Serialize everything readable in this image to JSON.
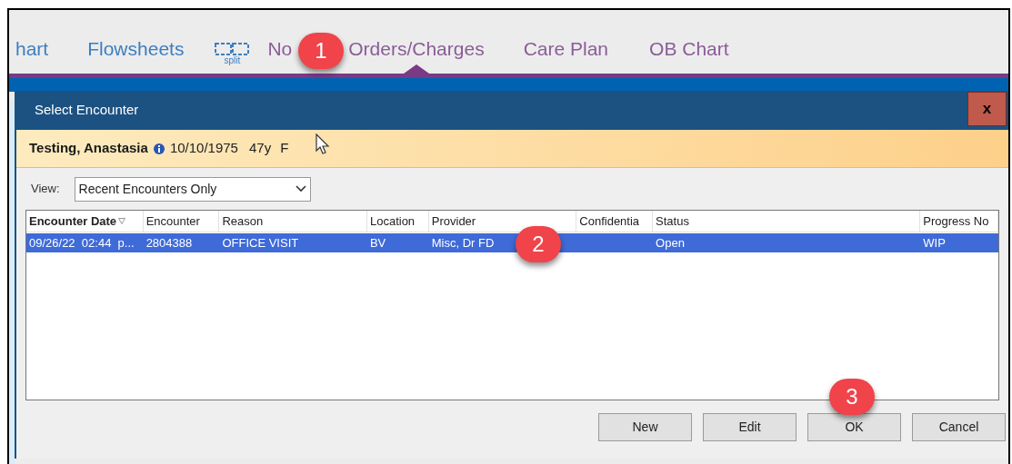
{
  "tabs": [
    {
      "label": "hart",
      "selected": false,
      "color": "#3c7fc0"
    },
    {
      "label": "Flowsheets",
      "selected": false,
      "color": "#3c7fc0"
    },
    {
      "kind": "split",
      "label": "split",
      "selected": false,
      "color": "#3c7fc0"
    },
    {
      "label": "No",
      "selected": false,
      "color": "#8a5c98"
    },
    {
      "label": "Orders/Charges",
      "selected": true,
      "color": "#8a5c98"
    },
    {
      "label": "Care Plan",
      "selected": false,
      "color": "#8a5c98"
    },
    {
      "label": "OB Chart",
      "selected": false,
      "color": "#8a5c98"
    }
  ],
  "dialog": {
    "title": "Select Encounter",
    "close": "x",
    "patient": {
      "name": "Testing, Anastasia",
      "dob": "10/10/1975",
      "age": "47y",
      "sex": "F"
    },
    "view": {
      "label": "View:",
      "value": "Recent Encounters Only"
    },
    "table": {
      "columns": [
        {
          "label": "Encounter Date",
          "sorted": true
        },
        {
          "label": "Encounter",
          "sorted": false
        },
        {
          "label": "Reason",
          "sorted": false
        },
        {
          "label": "Location",
          "sorted": false
        },
        {
          "label": "Provider",
          "sorted": false
        },
        {
          "label": "Confidentia",
          "sorted": false
        },
        {
          "label": "Status",
          "sorted": false
        },
        {
          "label": "Progress No",
          "sorted": false
        }
      ],
      "rows": [
        {
          "selected": true,
          "cells": [
            "09/26/22  02:44  p...",
            "2804388",
            "OFFICE VISIT",
            "BV",
            "Misc, Dr FD",
            "",
            "Open",
            "WIP"
          ]
        }
      ]
    },
    "buttons": [
      "New",
      "Edit",
      "OK",
      "Cancel"
    ]
  },
  "callouts": [
    "1",
    "2",
    "3"
  ]
}
